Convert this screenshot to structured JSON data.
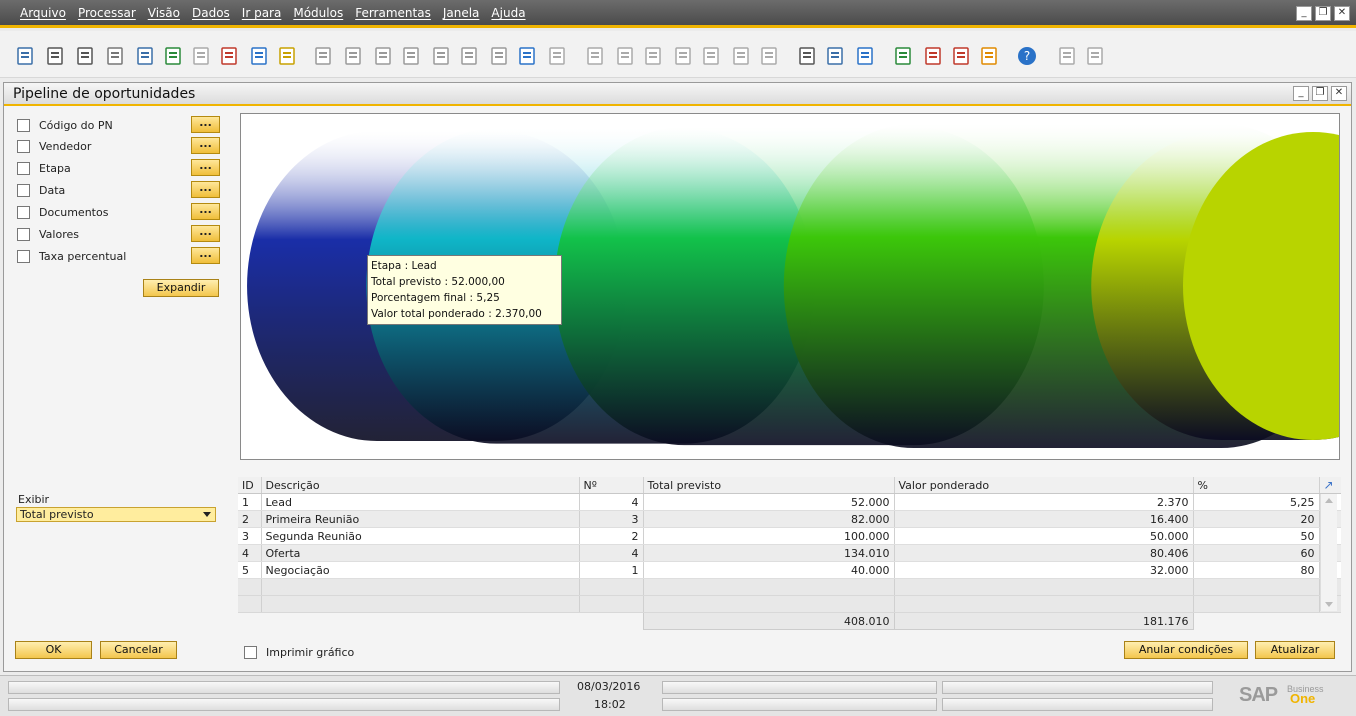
{
  "menu": [
    "Arquivo",
    "Processar",
    "Visão",
    "Dados",
    "Ir para",
    "Módulos",
    "Ferramentas",
    "Janela",
    "Ajuda"
  ],
  "window_buttons": {
    "minimize": "_",
    "restore": "❐",
    "close": "✕"
  },
  "toolbar_icons": [
    "preview-icon",
    "print-icon",
    "email-icon",
    "fax-icon",
    "sms-icon",
    "excel-icon",
    "word-icon",
    "pdf-icon",
    "launch-app-icon",
    "lock-icon",
    "find-icon",
    "add-icon",
    "first-record-icon",
    "previous-record-icon",
    "next-record-icon",
    "last-record-icon",
    "refresh-icon",
    "filter-icon",
    "sort-icon",
    "base-document-icon",
    "target-document-icon",
    "journal-icon",
    "payment-means-icon",
    "gross-profit-icon",
    "volume-icon",
    "drag-relate-icon",
    "edit-form-icon",
    "user-settings-icon",
    "settings-icon",
    "calendar-icon",
    "messages-icon",
    "reports-icon",
    "org-chart-icon",
    "help-icon",
    "document-a-icon",
    "document-b-icon"
  ],
  "form": {
    "title": "Pipeline de oportunidades",
    "filters": [
      "Código do PN",
      "Vendedor",
      "Etapa",
      "Data",
      "Documentos",
      "Valores",
      "Taxa percentual"
    ],
    "dots_label": "...",
    "expand_button": "Expandir",
    "exibir_label": "Exibir",
    "exibir_value": "Total previsto",
    "ok_button": "OK",
    "cancel_button": "Cancelar",
    "print_chart_label": "Imprimir gráfico",
    "clear_conditions_button": "Anular condições",
    "update_button": "Atualizar"
  },
  "tooltip": {
    "line1": "Etapa : Lead",
    "line2": "Total previsto : 52.000,00",
    "line3": "Porcentagem final : 5,25",
    "line4": "Valor total ponderado : 2.370,00"
  },
  "chart_data": {
    "type": "bar",
    "categories": [
      "Lead",
      "Primeira Reunião",
      "Segunda Reunião",
      "Oferta",
      "Negociação"
    ],
    "values": [
      52000,
      82000,
      100000,
      134010,
      40000
    ],
    "colors": [
      "#1a2ea8",
      "#0fb6c8",
      "#12c24a",
      "#3cc70a",
      "#b8d400"
    ]
  },
  "table": {
    "headers": [
      "ID",
      "Descrição",
      "Nº",
      "Total previsto",
      "Valor ponderado",
      "%"
    ],
    "rows": [
      [
        "1",
        "Lead",
        "4",
        "52.000",
        "2.370",
        "5,25"
      ],
      [
        "2",
        "Primeira Reunião",
        "3",
        "82.000",
        "16.400",
        "20"
      ],
      [
        "3",
        "Segunda Reunião",
        "2",
        "100.000",
        "50.000",
        "50"
      ],
      [
        "4",
        "Oferta",
        "4",
        "134.010",
        "80.406",
        "60"
      ],
      [
        "5",
        "Negociação",
        "1",
        "40.000",
        "32.000",
        "80"
      ]
    ],
    "totals": {
      "total_previsto": "408.010",
      "valor_ponderado": "181.176"
    }
  },
  "status": {
    "date": "08/03/2016",
    "time": "18:02"
  },
  "brand": {
    "sap": "SAP",
    "business": "Business",
    "one": "One"
  }
}
